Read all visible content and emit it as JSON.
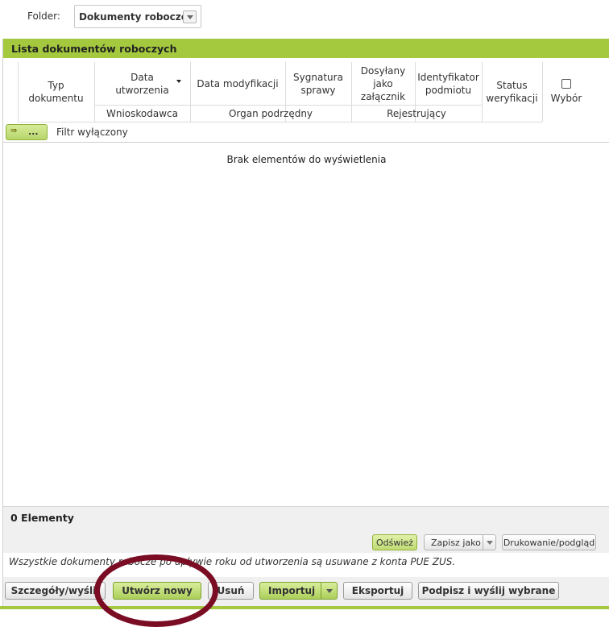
{
  "folder": {
    "label": "Folder:",
    "selected": "Dokumenty robocze"
  },
  "panel": {
    "title": "Lista dokumentów roboczych"
  },
  "columns": {
    "typ": "Typ dokumentu",
    "data_utworzenia": "Data utworzenia",
    "data_modyfikacji": "Data modyfikacji",
    "sygnatura": "Sygnatura sprawy",
    "dosylany": "Dosyłany jako załącznik",
    "identyfikator": "Identyfikator podmiotu",
    "status": "Status weryfikacji",
    "wybor": "Wybór",
    "wnioskodawca": "Wnioskodawca",
    "organ": "Organ podrzędny",
    "rejestrujacy": "Rejestrujący"
  },
  "filter": {
    "button_label": "...",
    "status_text": "Filtr wyłączony"
  },
  "grid": {
    "empty_message": "Brak elementów do wyświetlenia",
    "count_text": "0 Elementy"
  },
  "toolbar": {
    "refresh": "Odśwież",
    "save_as": "Zapisz jako",
    "print": "Drukowanie/podgląd"
  },
  "note": "Wszystkie dokumenty robocze po upływie roku od utworzenia są usuwane z konta PUE ZUS.",
  "actions": {
    "details": "Szczegóły/wyślij",
    "create": "Utwórz nowy",
    "delete": "Usuń",
    "import": "Importuj",
    "export": "Eksportuj",
    "sign_send": "Podpisz i wyślij wybrane"
  },
  "colors": {
    "accent": "#a4c93e",
    "highlight_ring": "#7a0c24"
  },
  "icons": {
    "folder_dropdown": "chevron-down-icon",
    "sort": "sort-desc-icon",
    "filter": "filter-icon"
  }
}
